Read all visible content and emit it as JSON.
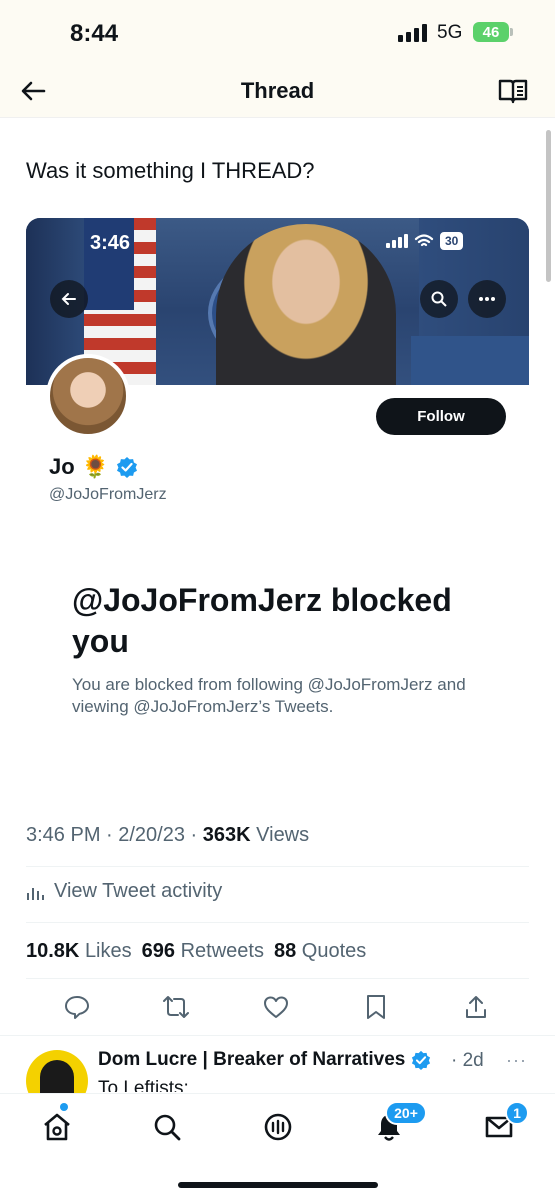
{
  "status_bar": {
    "time": "8:44",
    "network": "5G",
    "battery": "46"
  },
  "nav": {
    "title": "Thread"
  },
  "tweet": {
    "text": "Was it something I THREAD?"
  },
  "embedded": {
    "time": "3:46",
    "battery": "30",
    "follow_label": "Follow",
    "name": "Jo",
    "emoji": "🌻",
    "handle": "@JoJoFromJerz",
    "blocked_title": "@JoJoFromJerz blocked you",
    "blocked_desc": "You are blocked from following @JoJoFromJerz and viewing @JoJoFromJerz’s Tweets."
  },
  "meta": {
    "time": "3:46 PM · 2/20/23 · ",
    "views_count": "363K",
    "views_label": "Views"
  },
  "activity": {
    "label": "View Tweet activity"
  },
  "stats": {
    "likes_count": "10.8K",
    "likes_label": "Likes",
    "retweets_count": "696",
    "retweets_label": "Retweets",
    "quotes_count": "88",
    "quotes_label": "Quotes"
  },
  "reply": {
    "name": "Dom Lucre | Breaker of Narratives",
    "time": "· 2d",
    "more": "···",
    "text": "To Leftists:"
  },
  "tabbar": {
    "notifications_badge": "20+",
    "messages_badge": "1"
  },
  "colors": {
    "accent": "#1d9bf0",
    "text": "#0f1419",
    "muted": "#536471",
    "battery": "#5bd16a"
  },
  "icons": [
    "back-arrow-icon",
    "reader-icon",
    "verified-icon",
    "reply-icon",
    "retweet-icon",
    "like-icon",
    "bookmark-icon",
    "share-icon",
    "home-icon",
    "search-icon",
    "spaces-icon",
    "notifications-icon",
    "messages-icon"
  ]
}
